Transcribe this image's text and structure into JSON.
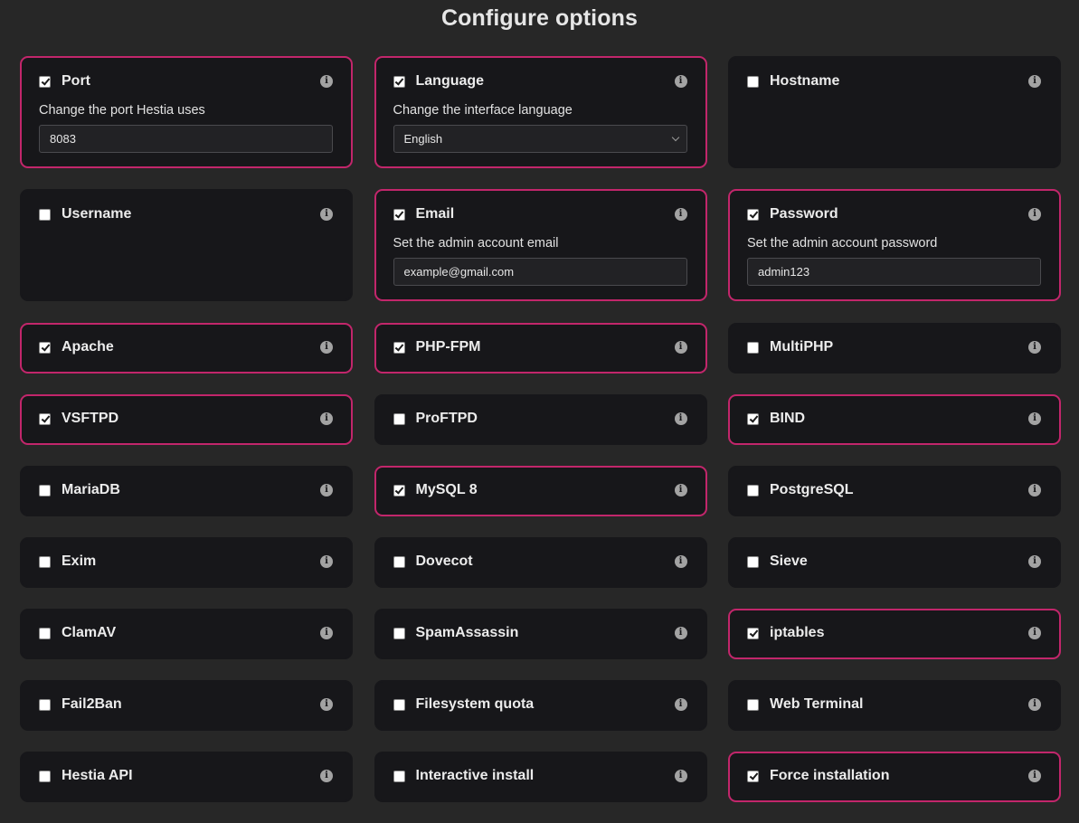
{
  "page": {
    "title": "Configure options"
  },
  "colors": {
    "background": "#272727",
    "card": "#17171a",
    "accent_border": "#c2266b"
  },
  "options": [
    {
      "label": "Port",
      "checked": true,
      "description": "Change the port Hestia uses",
      "field": {
        "type": "input",
        "value": "8083"
      }
    },
    {
      "label": "Language",
      "checked": true,
      "description": "Change the interface language",
      "field": {
        "type": "select",
        "value": "English"
      }
    },
    {
      "label": "Hostname",
      "checked": false
    },
    {
      "label": "Username",
      "checked": false
    },
    {
      "label": "Email",
      "checked": true,
      "description": "Set the admin account email",
      "field": {
        "type": "input",
        "value": "example@gmail.com"
      }
    },
    {
      "label": "Password",
      "checked": true,
      "description": "Set the admin account password",
      "field": {
        "type": "input",
        "value": "admin123"
      }
    },
    {
      "label": "Apache",
      "checked": true
    },
    {
      "label": "PHP-FPM",
      "checked": true
    },
    {
      "label": "MultiPHP",
      "checked": false
    },
    {
      "label": "VSFTPD",
      "checked": true
    },
    {
      "label": "ProFTPD",
      "checked": false
    },
    {
      "label": "BIND",
      "checked": true
    },
    {
      "label": "MariaDB",
      "checked": false
    },
    {
      "label": "MySQL 8",
      "checked": true
    },
    {
      "label": "PostgreSQL",
      "checked": false
    },
    {
      "label": "Exim",
      "checked": false
    },
    {
      "label": "Dovecot",
      "checked": false
    },
    {
      "label": "Sieve",
      "checked": false
    },
    {
      "label": "ClamAV",
      "checked": false
    },
    {
      "label": "SpamAssassin",
      "checked": false
    },
    {
      "label": "iptables",
      "checked": true
    },
    {
      "label": "Fail2Ban",
      "checked": false
    },
    {
      "label": "Filesystem quota",
      "checked": false
    },
    {
      "label": "Web Terminal",
      "checked": false
    },
    {
      "label": "Hestia API",
      "checked": false
    },
    {
      "label": "Interactive install",
      "checked": false
    },
    {
      "label": "Force installation",
      "checked": true
    }
  ],
  "icons": {
    "info": "info-icon",
    "checkbox": "checkbox",
    "select_arrow": "chevron-down-icon"
  }
}
